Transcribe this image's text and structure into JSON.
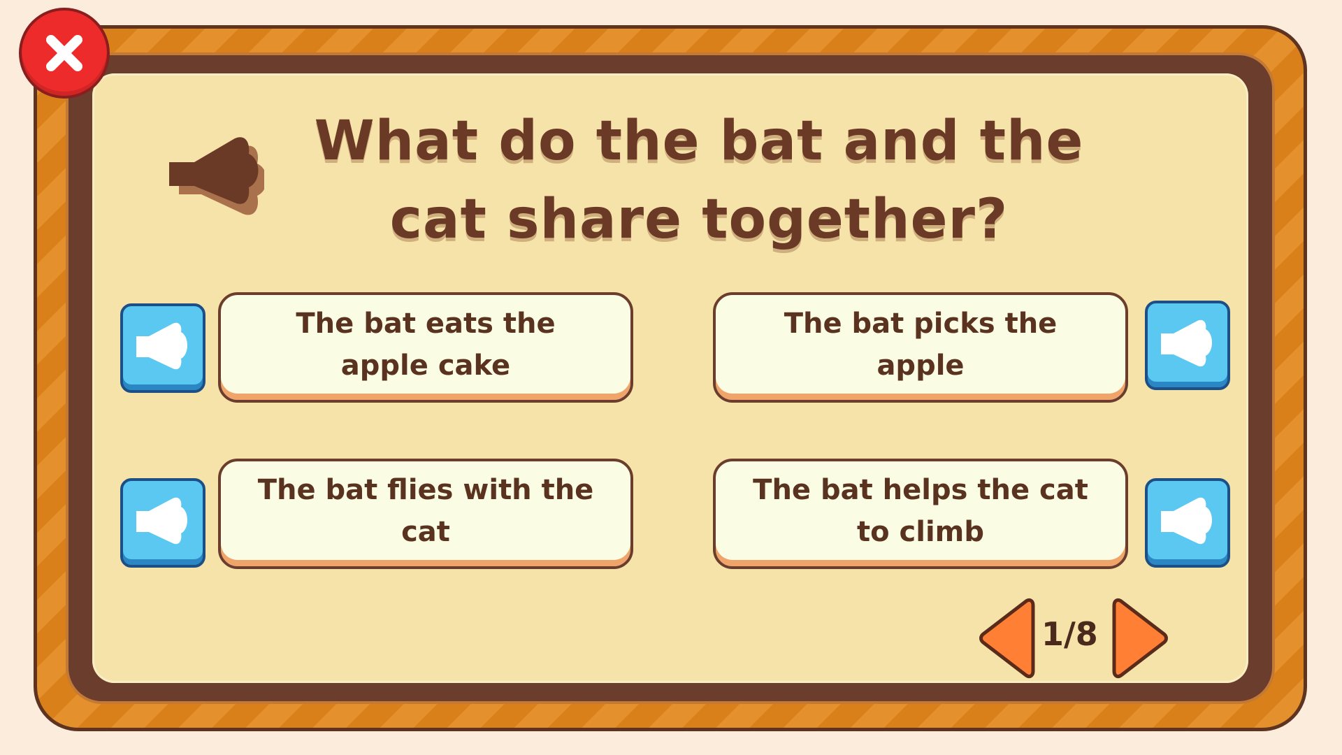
{
  "question": {
    "text": "What do the bat and the cat share together?",
    "audio_icon": "speaker-icon"
  },
  "answers": [
    {
      "label": "The bat eats the apple cake",
      "audio_icon": "speaker-icon"
    },
    {
      "label": "The bat picks the apple",
      "audio_icon": "speaker-icon"
    },
    {
      "label": "The bat flies with the cat",
      "audio_icon": "speaker-icon"
    },
    {
      "label": "The bat helps the cat to climb",
      "audio_icon": "speaker-icon"
    }
  ],
  "pagination": {
    "counter": "1/8",
    "prev_icon": "chevron-left-icon",
    "next_icon": "chevron-right-icon"
  },
  "close_icon": "close-icon",
  "colors": {
    "background": "#fbecdc",
    "frame_orange": "#d9801a",
    "frame_brown": "#6b3d2c",
    "panel": "#f6e3a9",
    "answer_bg": "#fbfce4",
    "sound_button": "#5bc8f2",
    "nav_arrow": "#ff7f35",
    "close_button": "#ee2b2b",
    "text": "#6b3a27"
  }
}
